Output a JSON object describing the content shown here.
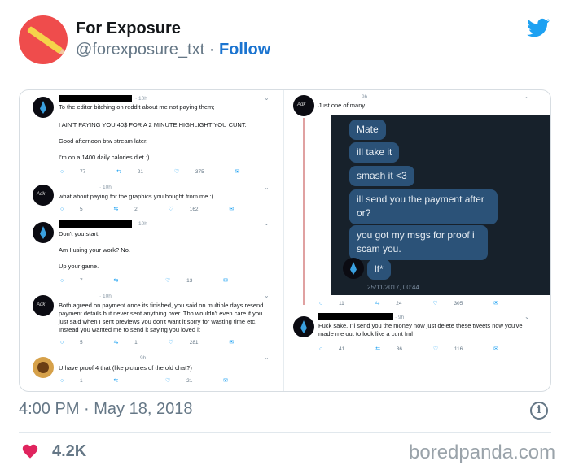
{
  "header": {
    "display_name": "For Exposure",
    "handle": "@forexposure_txt",
    "separator": " · ",
    "follow_label": "Follow"
  },
  "image": {
    "left": {
      "t1": {
        "time": "· 10h",
        "text": "To the editor bitching on reddit about me not paying them;",
        "line2": "I AIN'T PAYING YOU 40$ FOR A 2 MINUTE HIGHLIGHT YOU CUNT.",
        "line3": "Good afternoon btw stream later.",
        "line4": "I'm on a 1400 daily calories diet :)",
        "replies": "77",
        "retweets": "21",
        "likes": "375"
      },
      "t2": {
        "time": "· 10h",
        "text": "what about paying for the graphics you bought from me :(",
        "replies": "5",
        "retweets": "2",
        "likes": "162"
      },
      "t3": {
        "time": "· 10h",
        "text": "Don't you start.",
        "line2": "Am I using your work? No.",
        "line3": "Up your game.",
        "replies": "7",
        "retweets": "",
        "likes": "13"
      },
      "t4": {
        "time": "· 10h",
        "text": "Both agreed on payment once its finished, you said on multiple days resend payment details but never sent anything over. Tbh wouldn't even care if you just said when I sent previews you don't want it sorry for wasting time etc. Instead you wanted me to send it saying you loved it",
        "replies": "5",
        "retweets": "1",
        "likes": "281"
      },
      "t5": {
        "time": "9h",
        "text": "U have proof 4 that (like pictures of the old chat?)",
        "replies": "1",
        "retweets": "",
        "likes": "21"
      }
    },
    "right": {
      "t1": {
        "time": "9h",
        "text": "Just one of many",
        "replies": "11",
        "retweets": "24",
        "likes": "305"
      },
      "chat": {
        "m1": "Mate",
        "m2": "ill take it",
        "m3": "smash it <3",
        "m4": "ill send you the payment after or?",
        "m5": "you got my msgs for proof i scam you.",
        "m6": "lf*",
        "timestamp": "25/11/2017, 00:44"
      },
      "t2": {
        "time": "· 9h",
        "text": "Fuck sake. I'll send you the money now just delete these tweets now you've made me out to look like a cunt fml",
        "replies": "41",
        "retweets": "36",
        "likes": "116"
      }
    }
  },
  "footer": {
    "post_time": "4:00 PM · May 18, 2018",
    "likes": "4.2K",
    "watermark": "boredpanda.com",
    "info_glyph": "i"
  },
  "colors": {
    "twitter_blue": "#1da1f2",
    "follow_blue": "#1b74d0",
    "heart": "#e0245e",
    "chat_bg": "#17212b",
    "chat_bubble": "#2b5278"
  }
}
